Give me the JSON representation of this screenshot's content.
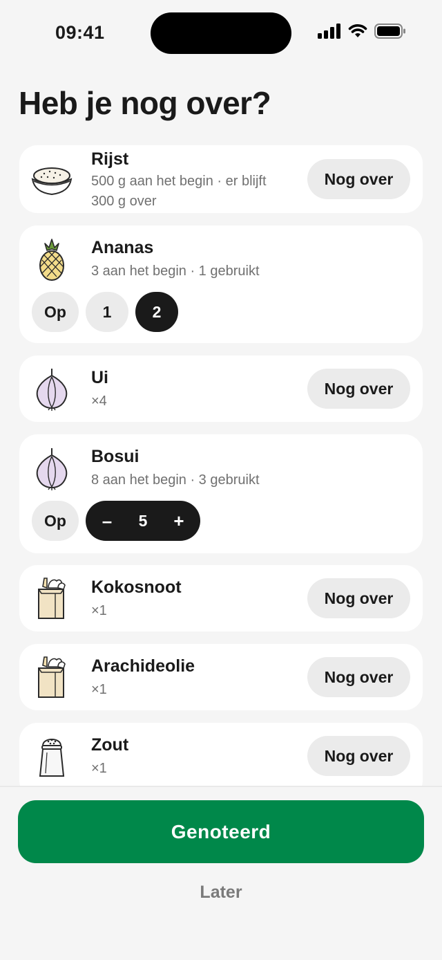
{
  "status_bar": {
    "time": "09:41"
  },
  "page_title": "Heb je nog over?",
  "items": [
    {
      "name": "Rijst",
      "meta_line1": "500 g aan het begin · er blijft",
      "meta_line2": "300 g over",
      "icon": "rice-bowl-icon",
      "action_label": "Nog over"
    },
    {
      "name": "Ananas",
      "meta": "3 aan het begin · 1 gebruikt",
      "icon": "pineapple-icon",
      "options": [
        "Op",
        "1",
        "2"
      ],
      "selected": "2"
    },
    {
      "name": "Ui",
      "meta": "×4",
      "icon": "onion-icon",
      "action_label": "Nog over"
    },
    {
      "name": "Bosui",
      "meta": "8 aan het begin · 3 gebruikt",
      "icon": "onion-icon",
      "op_label": "Op",
      "stepper": {
        "minus": "–",
        "value": "5",
        "plus": "+"
      }
    },
    {
      "name": "Kokosnoot",
      "meta": "×1",
      "icon": "grocery-bag-icon",
      "action_label": "Nog over"
    },
    {
      "name": "Arachideolie",
      "meta": "×1",
      "icon": "grocery-bag-icon",
      "action_label": "Nog over"
    },
    {
      "name": "Zout",
      "meta": "×1",
      "icon": "salt-shaker-icon",
      "action_label": "Nog over"
    }
  ],
  "primary_button": "Genoteerd",
  "secondary_link": "Later",
  "colors": {
    "primary": "#00884a",
    "dark_chip": "#1a1a1a",
    "light_chip": "#ebebeb",
    "background": "#f5f5f5"
  }
}
